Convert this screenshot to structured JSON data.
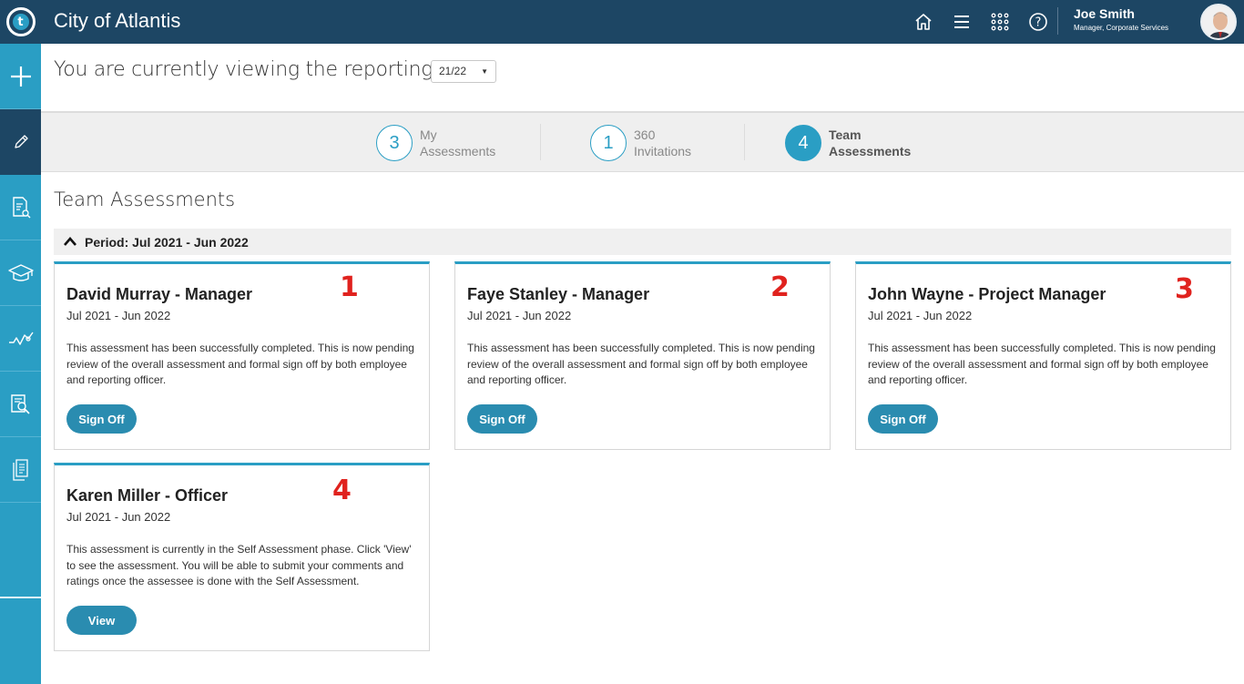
{
  "header": {
    "app_title": "City of Atlantis",
    "logo_letter": "t",
    "user_name": "Joe Smith",
    "user_role": "Manager, Corporate Services",
    "icons": [
      "home-icon",
      "menu-icon",
      "apps-grid-icon",
      "help-icon"
    ]
  },
  "sidebar": {
    "items": [
      "add-icon",
      "edit-icon",
      "document-search-icon",
      "graduation-cap-icon",
      "trend-chart-icon",
      "report-search-icon",
      "documents-icon"
    ]
  },
  "reporting": {
    "label": "You are currently viewing the reporting year",
    "year": "21/22"
  },
  "tabs": [
    {
      "count": "3",
      "line1": "My",
      "line2": "Assessments"
    },
    {
      "count": "1",
      "line1": "360",
      "line2": "Invitations"
    },
    {
      "count": "4",
      "line1": "Team",
      "line2": "Assessments"
    }
  ],
  "section_title": "Team Assessments",
  "period": "Period: Jul 2021 - Jun 2022",
  "cards": [
    {
      "title": "David Murray - Manager",
      "period": "Jul 2021 - Jun 2022",
      "desc": "This assessment has been successfully completed. This is now pending review of the overall assessment and formal sign off by both employee and reporting officer.",
      "button": "Sign Off",
      "marker": "1"
    },
    {
      "title": "Faye Stanley - Manager",
      "period": "Jul 2021 - Jun 2022",
      "desc": "This assessment has been successfully completed. This is now pending review of the overall assessment and formal sign off by both employee and reporting officer.",
      "button": "Sign Off",
      "marker": "2"
    },
    {
      "title": "John Wayne - Project Manager",
      "period": "Jul 2021 - Jun 2022",
      "desc": "This assessment has been successfully completed. This is now pending review of the overall assessment and formal sign off by both employee and reporting officer.",
      "button": "Sign Off",
      "marker": "3"
    },
    {
      "title": "Karen Miller - Officer",
      "period": "Jul 2021 - Jun 2022",
      "desc": "This assessment is currently in the Self Assessment phase. Click 'View' to see the assessment. You will be able to submit your comments and ratings once the assessee is done with the Self Assessment.",
      "button": "View",
      "marker": "4"
    }
  ],
  "colors": {
    "primary": "#2a9ec4",
    "header": "#1d4664",
    "marker": "#e0221e"
  }
}
